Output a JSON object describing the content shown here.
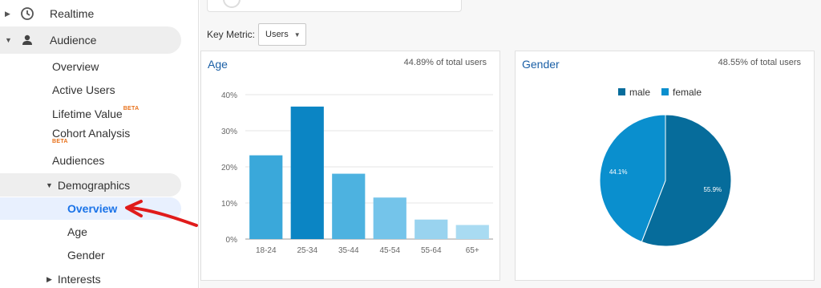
{
  "sidebar": {
    "realtime_label": "Realtime",
    "audience_label": "Audience",
    "items": {
      "overview": "Overview",
      "active_users": "Active Users",
      "lifetime_value": "Lifetime Value",
      "lifetime_value_badge": "BETA",
      "cohort_analysis": "Cohort Analysis",
      "cohort_badge": "BETA",
      "audiences": "Audiences",
      "demographics": "Demographics",
      "demo_overview": "Overview",
      "demo_age": "Age",
      "demo_gender": "Gender",
      "interests": "Interests"
    }
  },
  "toolbar": {
    "key_metric_label": "Key Metric:",
    "key_metric_value": "Users"
  },
  "age_panel": {
    "title": "Age",
    "share": "44.89% of total users"
  },
  "gender_panel": {
    "title": "Gender",
    "share": "48.55% of total users"
  },
  "colors": {
    "accent_blue": "#1a73e8",
    "male": "#066c9b",
    "female": "#0a8fce",
    "annotation_arrow": "#e01b1b"
  },
  "chart_data": [
    {
      "type": "bar",
      "title": "Age",
      "categories": [
        "18-24",
        "25-34",
        "35-44",
        "45-54",
        "55-64",
        "65+"
      ],
      "values": [
        23.2,
        36.7,
        18.1,
        11.5,
        5.4,
        3.9
      ],
      "bar_colors": [
        "#3aa8da",
        "#0b85c4",
        "#4db2e0",
        "#74c4ea",
        "#99d3ef",
        "#a9dbf2"
      ],
      "yticks": [
        "0%",
        "10%",
        "20%",
        "30%",
        "40%"
      ],
      "ylim": [
        0,
        40
      ],
      "grid": true
    },
    {
      "type": "pie",
      "title": "Gender",
      "labels": [
        "male",
        "female"
      ],
      "values": [
        55.9,
        44.1
      ],
      "value_labels": [
        "55.9%",
        "44.1%"
      ],
      "colors": [
        "#066c9b",
        "#0a8fce"
      ],
      "legend": "top"
    }
  ]
}
